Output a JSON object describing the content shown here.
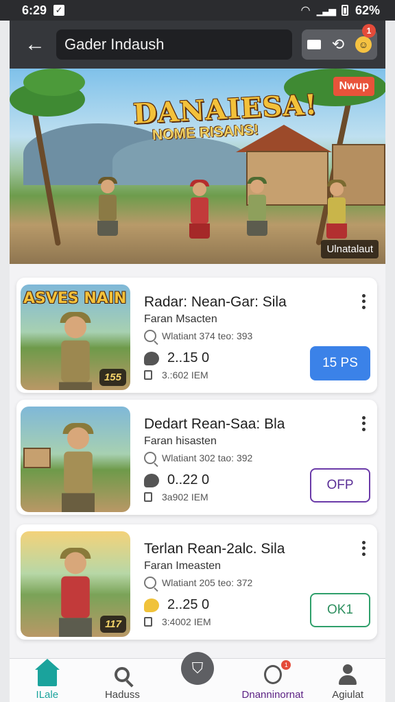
{
  "status_bar": {
    "time": "6:29",
    "battery": "62%"
  },
  "app_bar": {
    "search_value": "Gader Indaush",
    "notification_count": "1"
  },
  "banner": {
    "title": "DANAIESA!",
    "subtitle": "NOME RISANS!",
    "badge": "Nwup",
    "caption": "Ulnatalaut"
  },
  "games": [
    {
      "thumb_label": "ASVES NAIN",
      "thumb_chip": "155",
      "title": "Radar: Nean-Gar: Sila",
      "subtitle": "Faran Msacten",
      "meta": "Wlatiant 374 teo: 393",
      "stat": "2..15 0",
      "size": "3.:602 IEM",
      "button": "15 PS",
      "button_style": "filled-blue"
    },
    {
      "thumb_label": "",
      "thumb_chip": "",
      "title": "Dedart Rean-Saa: Bla",
      "subtitle": "Faran hisasten",
      "meta": "Wlatiant 302 tao: 392",
      "stat": "0..22 0",
      "size": "3a902 IEM",
      "button": "OFP",
      "button_style": "outlined-purple"
    },
    {
      "thumb_label": "",
      "thumb_chip": "117",
      "title": "Terlan Rean-2alc. Sila",
      "subtitle": "Faran Imeasten",
      "meta": "Wlatiant 205 teo: 372",
      "stat": "2..25 0",
      "size": "3:4002 IEM",
      "button": "OK1",
      "button_style": "outlined-green"
    }
  ],
  "bottom_nav": {
    "items": [
      {
        "label": "ILale",
        "icon": "home-icon"
      },
      {
        "label": "Haduss",
        "icon": "search-icon"
      },
      {
        "label": "",
        "icon": "shield-icon"
      },
      {
        "label": "Dnanninornat",
        "icon": "downloads-icon",
        "badge": "1"
      },
      {
        "label": "Agiulat",
        "icon": "profile-icon"
      }
    ]
  },
  "colors": {
    "accent_blue": "#3b82e8",
    "accent_purple": "#6a3aa8",
    "accent_green": "#2e9f6a",
    "home_teal": "#1aa39c",
    "badge_red": "#e44b3a"
  }
}
